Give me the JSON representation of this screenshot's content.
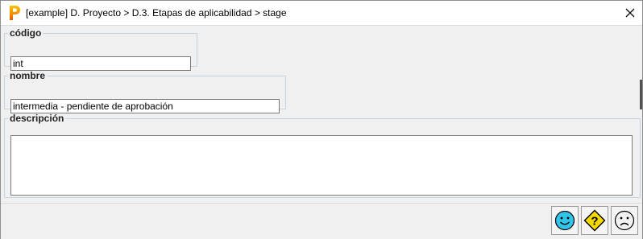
{
  "window": {
    "title": "[example] D. Proyecto > D.3. Etapas de aplicabilidad > stage",
    "app_icon": "app-logo-p-icon",
    "close_icon": "close-icon"
  },
  "form": {
    "codigo": {
      "label": "código",
      "value": "int"
    },
    "nombre": {
      "label": "nombre",
      "value": "intermedia - pendiente de aprobación"
    },
    "descripcion": {
      "label": "descripción",
      "value": ""
    }
  },
  "actions": {
    "ok_icon": "smiley-happy-icon",
    "help_icon": "question-warning-icon",
    "cancel_icon": "smiley-sad-icon"
  },
  "colors": {
    "ok_face": "#2fc4e8",
    "help_sign": "#f5d800",
    "cancel_face": "#f2f2f2",
    "fieldset_border": "#c5d3e0"
  }
}
